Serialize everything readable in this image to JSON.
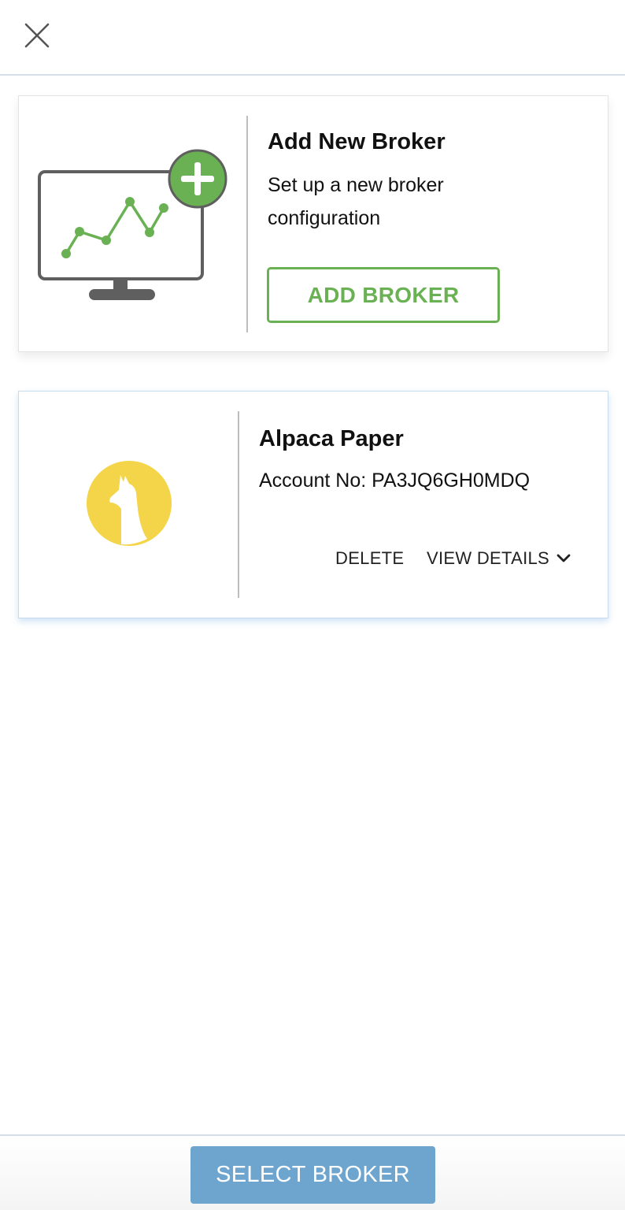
{
  "header": {
    "close_icon": "close-icon"
  },
  "add_card": {
    "illustration_icon": "monitor-chart-plus-icon",
    "title": "Add New Broker",
    "description": "Set up a new broker configuration",
    "button_label": "ADD BROKER"
  },
  "broker_card": {
    "logo_icon": "alpaca-logo-icon",
    "name": "Alpaca Paper",
    "account": "Account No: PA3JQ6GH0MDQ",
    "delete_label": "DELETE",
    "details_label": "VIEW DETAILS",
    "details_icon": "chevron-down-icon"
  },
  "footer": {
    "select_label": "SELECT BROKER"
  },
  "colors": {
    "green_accent": "#6ab154",
    "blue_button": "#6ea5cf",
    "alpaca_yellow": "#f4d54a",
    "monitor_gray": "#5f5f5f"
  }
}
